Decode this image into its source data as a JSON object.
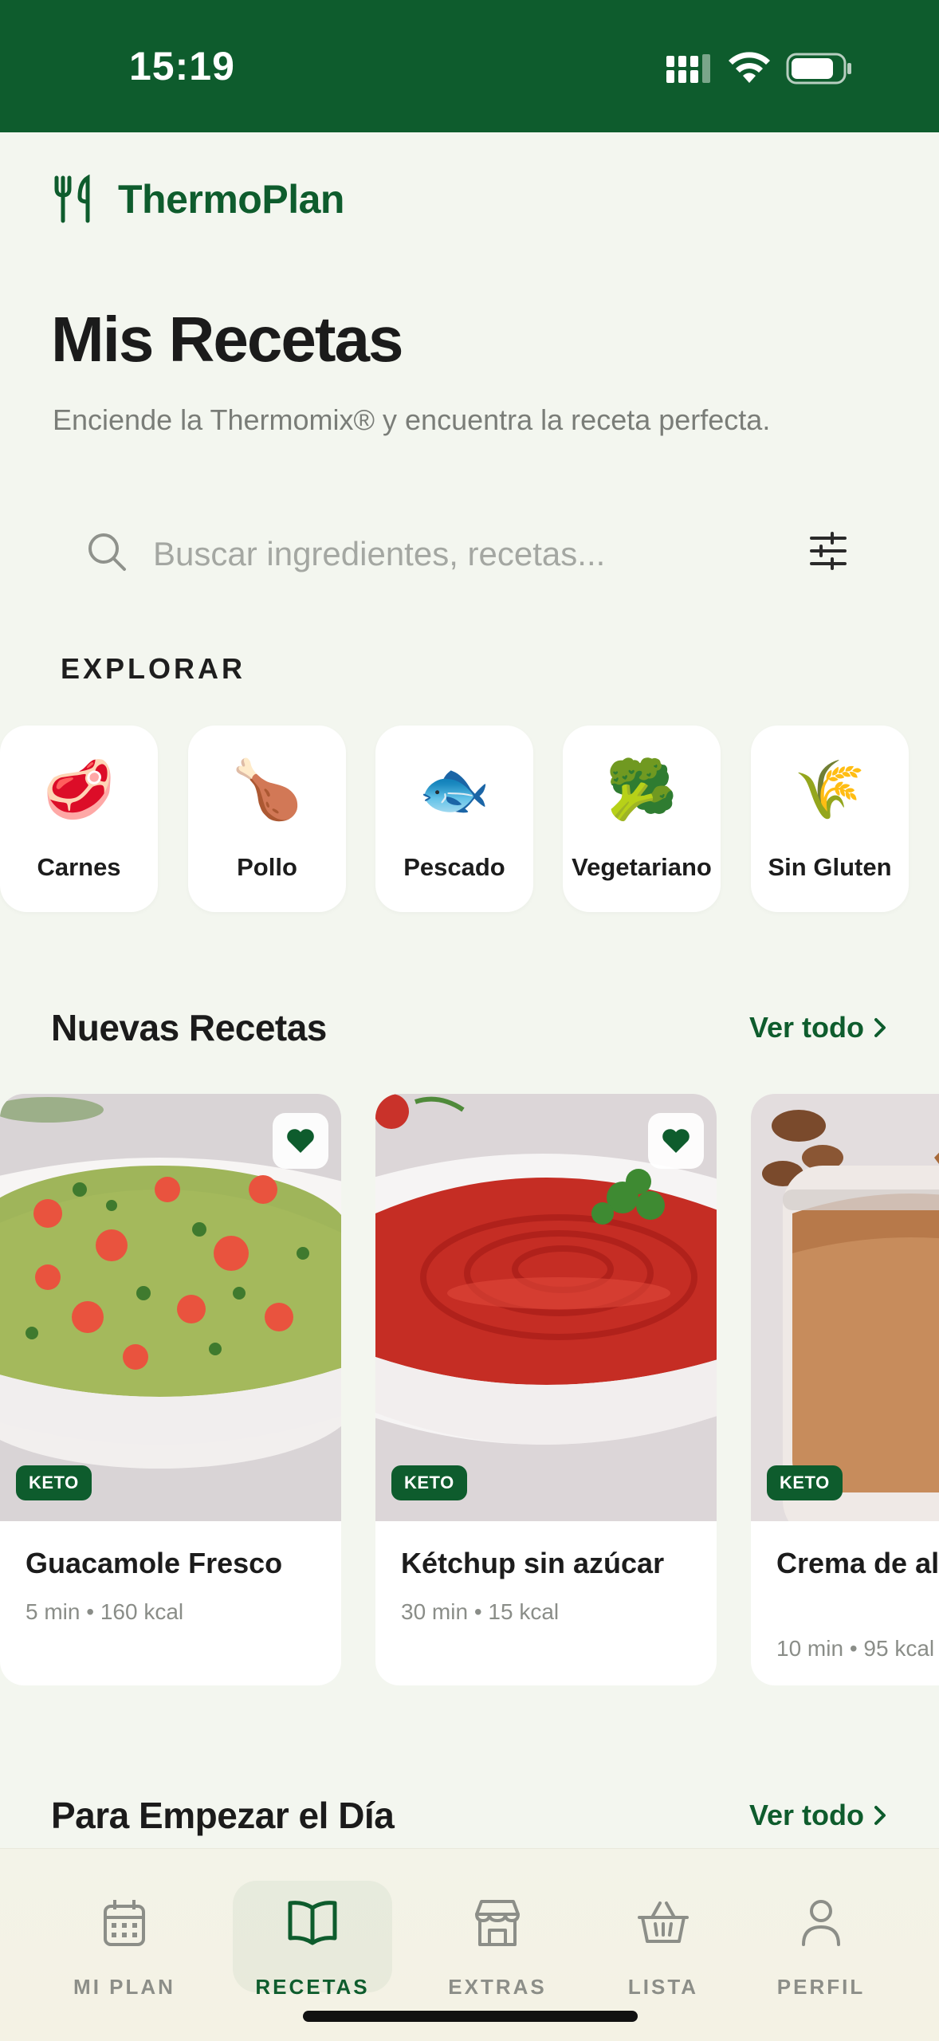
{
  "status_bar": {
    "time": "15:19"
  },
  "brand": {
    "name": "ThermoPlan"
  },
  "header": {
    "title": "Mis Recetas",
    "subtitle": "Enciende la Thermomix® y encuentra la receta perfecta."
  },
  "search": {
    "placeholder": "Buscar ingredientes, recetas..."
  },
  "explore": {
    "label": "EXPLORAR",
    "categories": [
      {
        "emoji": "🥩",
        "label": "Carnes"
      },
      {
        "emoji": "🍗",
        "label": "Pollo"
      },
      {
        "emoji": "🐟",
        "label": "Pescado"
      },
      {
        "emoji": "🥦",
        "label": "Vegetariano"
      },
      {
        "emoji": "🌾",
        "label": "Sin Gluten"
      }
    ]
  },
  "new_recipes": {
    "title": "Nuevas Recetas",
    "see_all": "Ver todo",
    "items": [
      {
        "name": "Guacamole Fresco",
        "meta": "5 min • 160 kcal",
        "badge": "KETO",
        "favorite": true
      },
      {
        "name": "Kétchup sin azúcar",
        "meta": "30 min • 15 kcal",
        "badge": "KETO",
        "favorite": true
      },
      {
        "name": "Crema de almendras",
        "meta": "10 min • 95 kcal",
        "badge": "KETO",
        "favorite": false
      }
    ]
  },
  "breakfast": {
    "title": "Para Empezar el Día",
    "see_all": "Ver todo"
  },
  "nav": {
    "items": [
      {
        "label": "MI PLAN",
        "icon": "calendar-icon",
        "active": false
      },
      {
        "label": "RECETAS",
        "icon": "book-icon",
        "active": true
      },
      {
        "label": "EXTRAS",
        "icon": "store-icon",
        "active": false
      },
      {
        "label": "LISTA",
        "icon": "basket-icon",
        "active": false
      },
      {
        "label": "PERFIL",
        "icon": "user-icon",
        "active": false
      }
    ]
  },
  "colors": {
    "brand_green": "#0e5c2d",
    "background": "#f3f6ef",
    "muted_text": "#7a7d78"
  }
}
